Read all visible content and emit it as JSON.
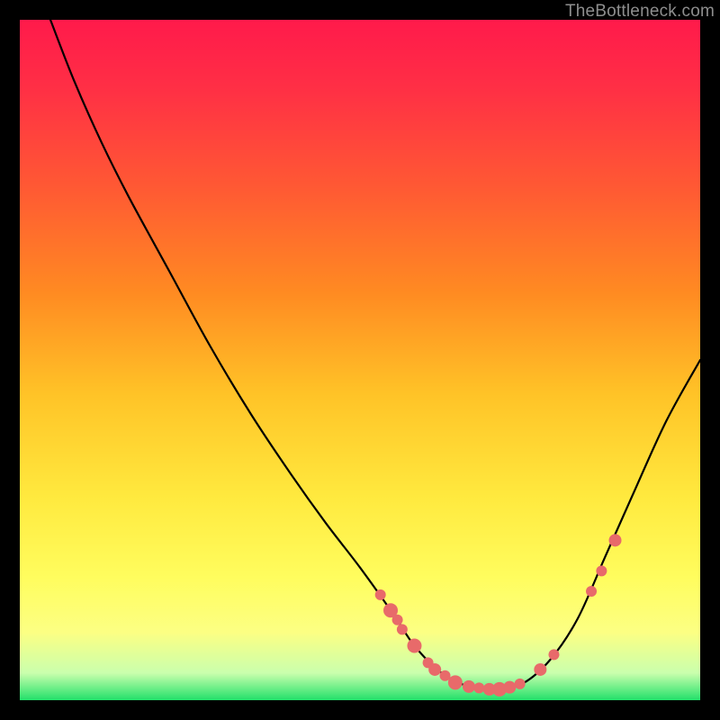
{
  "watermark": "TheBottleneck.com",
  "chart_data": {
    "type": "line",
    "title": "",
    "xlabel": "",
    "ylabel": "",
    "xlim": [
      0,
      100
    ],
    "ylim": [
      0,
      100
    ],
    "gradient_stops": [
      {
        "offset": 0.0,
        "color": "#ff1a4b"
      },
      {
        "offset": 0.1,
        "color": "#ff2f45"
      },
      {
        "offset": 0.25,
        "color": "#ff5a33"
      },
      {
        "offset": 0.4,
        "color": "#ff8a22"
      },
      {
        "offset": 0.55,
        "color": "#ffc327"
      },
      {
        "offset": 0.7,
        "color": "#ffe93e"
      },
      {
        "offset": 0.82,
        "color": "#fffd5e"
      },
      {
        "offset": 0.9,
        "color": "#fcff83"
      },
      {
        "offset": 0.96,
        "color": "#caffad"
      },
      {
        "offset": 1.0,
        "color": "#22e06a"
      }
    ],
    "curve_points": [
      {
        "x": 4.5,
        "y": 100.0
      },
      {
        "x": 8.0,
        "y": 91.0
      },
      {
        "x": 12.0,
        "y": 82.0
      },
      {
        "x": 16.0,
        "y": 74.0
      },
      {
        "x": 22.0,
        "y": 63.0
      },
      {
        "x": 28.0,
        "y": 52.0
      },
      {
        "x": 34.0,
        "y": 42.0
      },
      {
        "x": 40.0,
        "y": 33.0
      },
      {
        "x": 45.0,
        "y": 26.0
      },
      {
        "x": 50.0,
        "y": 19.5
      },
      {
        "x": 55.0,
        "y": 12.5
      },
      {
        "x": 58.0,
        "y": 8.0
      },
      {
        "x": 62.0,
        "y": 4.0
      },
      {
        "x": 66.0,
        "y": 2.0
      },
      {
        "x": 70.0,
        "y": 1.5
      },
      {
        "x": 74.0,
        "y": 2.5
      },
      {
        "x": 78.0,
        "y": 6.0
      },
      {
        "x": 82.0,
        "y": 12.0
      },
      {
        "x": 86.0,
        "y": 21.0
      },
      {
        "x": 90.0,
        "y": 30.0
      },
      {
        "x": 95.0,
        "y": 41.0
      },
      {
        "x": 100.0,
        "y": 50.0
      }
    ],
    "markers": [
      {
        "x": 53.0,
        "y": 15.5,
        "r": 6
      },
      {
        "x": 54.5,
        "y": 13.2,
        "r": 8
      },
      {
        "x": 55.5,
        "y": 11.8,
        "r": 6
      },
      {
        "x": 56.2,
        "y": 10.4,
        "r": 6
      },
      {
        "x": 58.0,
        "y": 8.0,
        "r": 8
      },
      {
        "x": 60.0,
        "y": 5.5,
        "r": 6
      },
      {
        "x": 61.0,
        "y": 4.5,
        "r": 7
      },
      {
        "x": 62.5,
        "y": 3.6,
        "r": 6
      },
      {
        "x": 64.0,
        "y": 2.6,
        "r": 8
      },
      {
        "x": 66.0,
        "y": 2.0,
        "r": 7
      },
      {
        "x": 67.5,
        "y": 1.8,
        "r": 6
      },
      {
        "x": 69.0,
        "y": 1.6,
        "r": 7
      },
      {
        "x": 70.5,
        "y": 1.6,
        "r": 8
      },
      {
        "x": 72.0,
        "y": 1.9,
        "r": 7
      },
      {
        "x": 73.5,
        "y": 2.4,
        "r": 6
      },
      {
        "x": 76.5,
        "y": 4.5,
        "r": 7
      },
      {
        "x": 78.5,
        "y": 6.7,
        "r": 6
      },
      {
        "x": 84.0,
        "y": 16.0,
        "r": 6
      },
      {
        "x": 85.5,
        "y": 19.0,
        "r": 6
      },
      {
        "x": 87.5,
        "y": 23.5,
        "r": 7
      }
    ]
  }
}
